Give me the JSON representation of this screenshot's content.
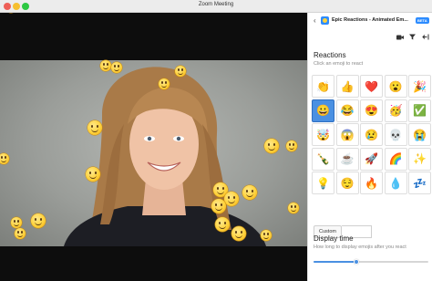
{
  "window": {
    "title": "Zoom Meeting"
  },
  "panel": {
    "back_icon": "‹",
    "app_name": "Epic Reactions - Animated Em...",
    "beta_label": "BETA",
    "toolbar_icons": [
      "video-icon",
      "filter-icon",
      "collapse-icon"
    ],
    "reactions_title": "Reactions",
    "reactions_subtitle": "Click an emoji to react",
    "emojis": [
      {
        "name": "clapping-hands",
        "glyph": "👏"
      },
      {
        "name": "thumbs-up",
        "glyph": "👍"
      },
      {
        "name": "red-heart",
        "glyph": "❤️"
      },
      {
        "name": "astonished-face",
        "glyph": "😮"
      },
      {
        "name": "party-popper",
        "glyph": "🎉"
      },
      {
        "name": "grinning-face",
        "glyph": "😀",
        "selected": true
      },
      {
        "name": "laughing-face",
        "glyph": "😂"
      },
      {
        "name": "heart-eyes",
        "glyph": "😍"
      },
      {
        "name": "partying-face",
        "glyph": "🥳"
      },
      {
        "name": "check-mark",
        "glyph": "✅"
      },
      {
        "name": "exploding-head",
        "glyph": "🤯"
      },
      {
        "name": "screaming-face",
        "glyph": "😱"
      },
      {
        "name": "sad-face",
        "glyph": "😢"
      },
      {
        "name": "skull",
        "glyph": "💀"
      },
      {
        "name": "crying-face",
        "glyph": "😭"
      },
      {
        "name": "bottle",
        "glyph": "🍾"
      },
      {
        "name": "coffee",
        "glyph": "☕"
      },
      {
        "name": "rocket",
        "glyph": "🚀"
      },
      {
        "name": "rainbow",
        "glyph": "🌈"
      },
      {
        "name": "sparkles",
        "glyph": "✨"
      },
      {
        "name": "light-bulb",
        "glyph": "💡"
      },
      {
        "name": "relieved-face",
        "glyph": "😌"
      },
      {
        "name": "fire",
        "glyph": "🔥"
      },
      {
        "name": "droplet",
        "glyph": "💧"
      },
      {
        "name": "zzz",
        "glyph": "💤"
      }
    ],
    "custom_label": "Custom",
    "custom_value": "",
    "display_time_title": "Display time",
    "display_time_subtitle": "How long to display emojis after you react",
    "display_time_level": 0.37
  },
  "colors": {
    "accent": "#4a90e2",
    "video_bg": "#0d0d0d",
    "emoji_yellow": "#ffd23c"
  }
}
